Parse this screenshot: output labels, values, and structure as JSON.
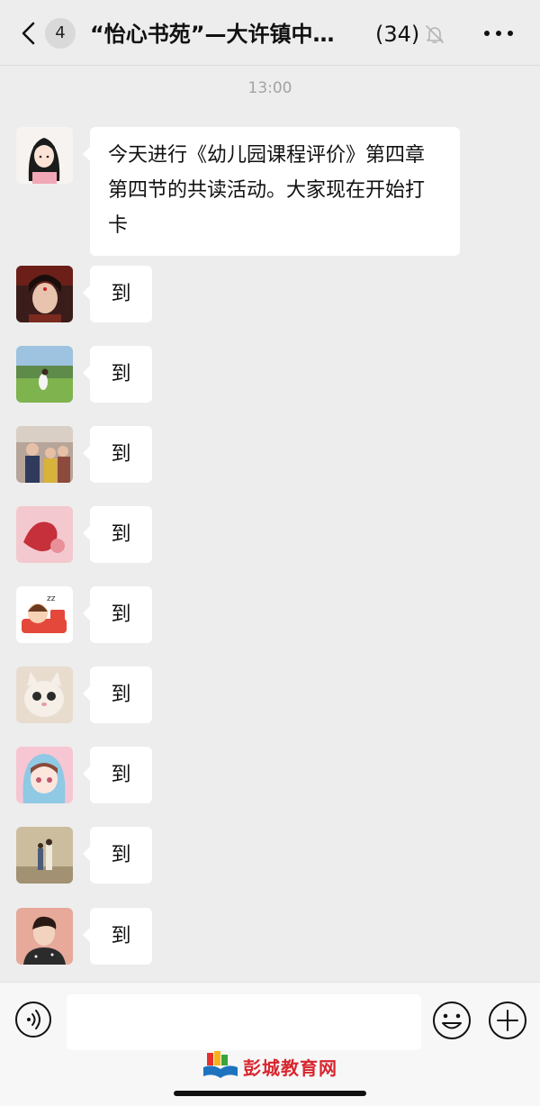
{
  "header": {
    "unread_count": "4",
    "title": "“怡心书苑”—大许镇中…",
    "member_count": "(34)",
    "icons": {
      "back": "chevron-left-icon",
      "mute": "bell-off-icon",
      "more": "more-dots-icon"
    }
  },
  "timestamp": "13:00",
  "messages": [
    {
      "avatar": "avatar-girl-cartoon",
      "text": "今天进行《幼儿园课程评价》第四章第四节的共读活动。大家现在开始打卡"
    },
    {
      "avatar": "avatar-costume-portrait",
      "text": "到"
    },
    {
      "avatar": "avatar-girl-on-grass",
      "text": "到"
    },
    {
      "avatar": "avatar-group-photo",
      "text": "到"
    },
    {
      "avatar": "avatar-pink-abstract",
      "text": "到"
    },
    {
      "avatar": "avatar-sleeping-cartoon",
      "text": "到"
    },
    {
      "avatar": "avatar-white-cat",
      "text": "到"
    },
    {
      "avatar": "avatar-hooded-girl-cartoon",
      "text": "到"
    },
    {
      "avatar": "avatar-two-people-wall",
      "text": "到"
    },
    {
      "avatar": "avatar-boy-cartoon",
      "text": "到"
    }
  ],
  "input_bar": {
    "icons": {
      "voice": "voice-icon",
      "emoji": "emoji-icon",
      "plus": "plus-icon"
    }
  },
  "watermark": {
    "text": "彭城教育网"
  },
  "colors": {
    "background": "#ededed",
    "bubble": "#ffffff",
    "timestamp": "#a3a3a3",
    "watermark": "#d8262e"
  }
}
